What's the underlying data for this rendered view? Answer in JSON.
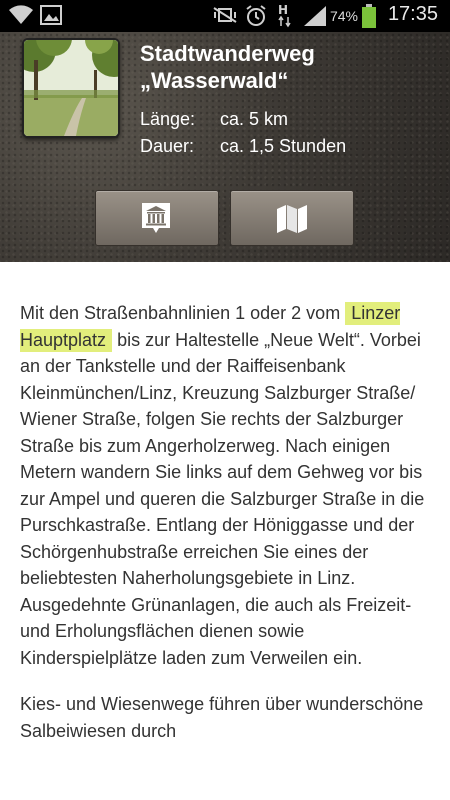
{
  "status_bar": {
    "icons": [
      "wifi-icon",
      "image-icon",
      "silent-icon",
      "alarm-icon",
      "hspa-icon",
      "signal-icon",
      "battery-icon"
    ],
    "battery": "74%",
    "time": "17:35"
  },
  "header": {
    "title_line1": "Stadtwanderweg",
    "title_line2": "„Wasserwald“",
    "length_label": "Länge:",
    "length_value": "ca. 5 km",
    "duration_label": "Dauer:",
    "duration_value": "ca. 1,5 Stunden",
    "buttons": [
      "museum-icon",
      "map-icon"
    ]
  },
  "content": {
    "p1_before": "Mit den Straßenbahnlinien 1 oder 2 vom",
    "p1_link": "Linzer Hauptplatz",
    "p1_after": " bis zur Haltestelle „Neue Welt“. Vorbei an der Tankstelle und der Raiffeisenbank Kleinmünchen/Linz, Kreuzung Salzburger Straße/ Wiener Straße, folgen Sie rechts der Salzburger Straße bis zum Angerholzerweg. Nach einigen Metern wandern Sie links auf dem Gehweg vor bis zur Ampel und queren die Salzburger Straße in die Purschkastraße. Entlang der Höniggasse und der Schörgenhubstraße erreichen Sie eines der beliebtesten Naherholungsgebiete in Linz. Ausgedehnte Grünanlagen, die auch als Freizeit- und Erholungsflächen dienen sowie Kinderspielplätze laden zum Verweilen ein.",
    "p2": "Kies- und Wiesenwege führen über wunderschöne Salbeiwiesen durch"
  }
}
